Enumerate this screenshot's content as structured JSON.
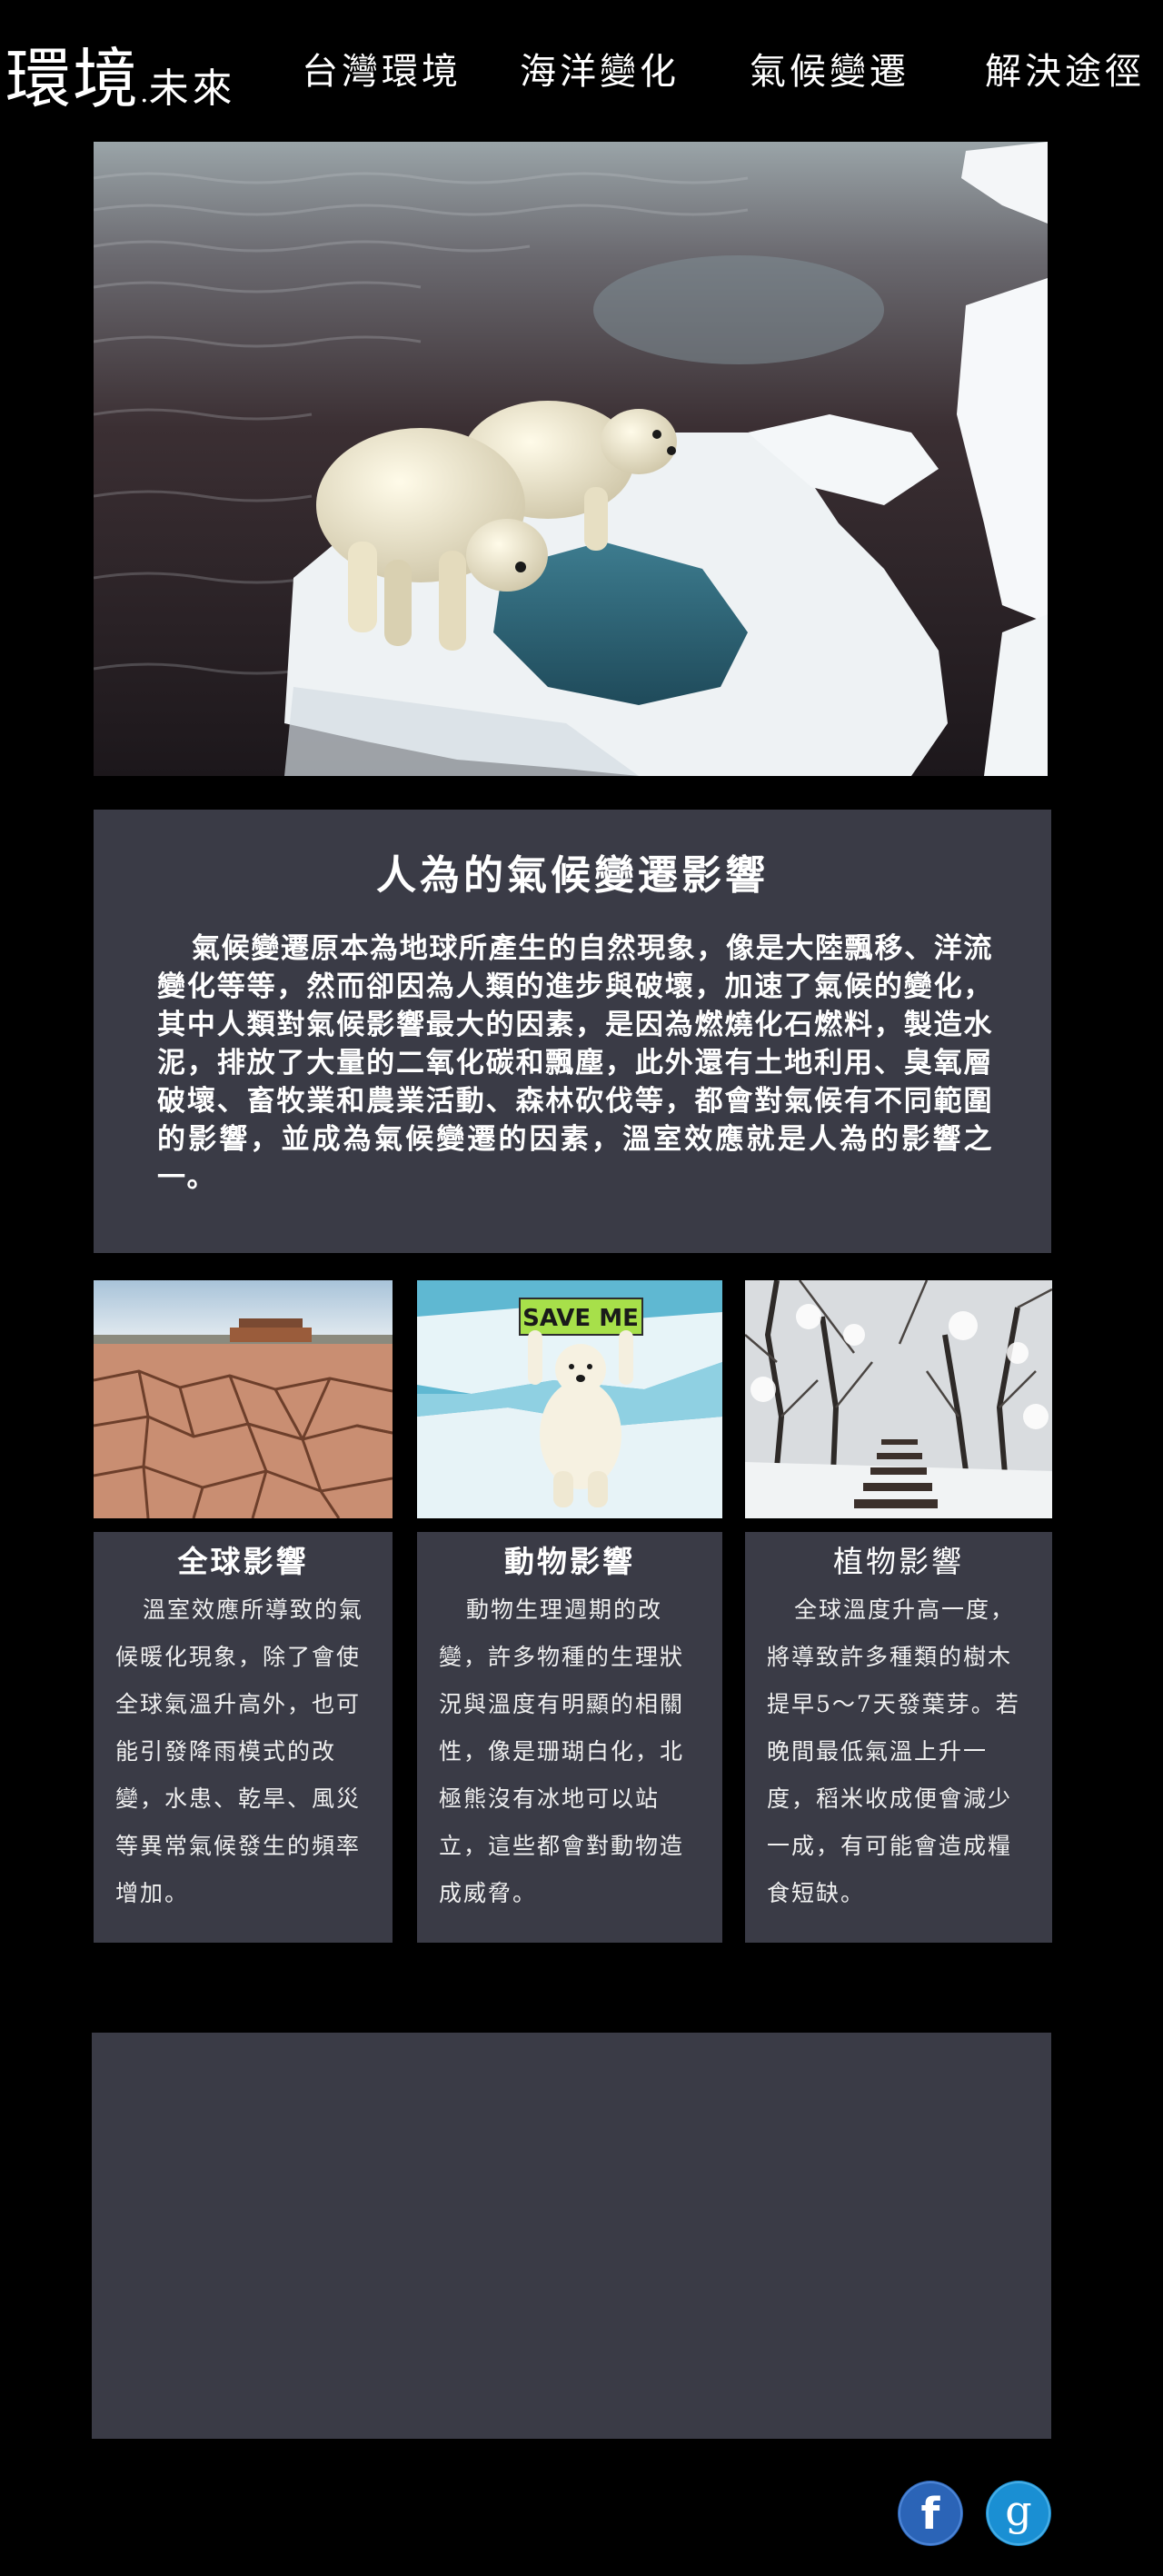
{
  "header": {
    "logo_main": "環境",
    "logo_dot": ".",
    "logo_sub": "未來",
    "nav": [
      {
        "label": "台灣環境"
      },
      {
        "label": "海洋變化"
      },
      {
        "label": "氣候變遷"
      },
      {
        "label": "解決途徑"
      }
    ]
  },
  "hero": {
    "image": "polar-bears-on-melting-ice-floe"
  },
  "intro": {
    "title": "人為的氣候變遷影響",
    "body": "氣候變遷原本為地球所產生的自然現象，像是大陸飄移、洋流變化等等，然而卻因為人類的進步與破壞，加速了氣候的變化，其中人類對氣候影響最大的因素，是因為燃燒化石燃料，製造水泥，排放了大量的二氧化碳和飄塵，此外還有土地利用、臭氧層破壞、畜牧業和農業活動、森林砍伐等，都會對氣候有不同範圍的影響，並成為氣候變遷的因素，溫室效應就是人為的影響之一。"
  },
  "cards": [
    {
      "image": "cracked-dry-earth",
      "title": "全球影響",
      "body": "溫室效應所導致的氣候暖化現象，除了會使全球氣溫升高外，也可能引發降雨模式的改變，水患、乾旱、風災等異常氣候發生的頻率增加。"
    },
    {
      "image": "polar-bear-holding-sign",
      "sign_text": "SAVE ME",
      "title": "動物影響",
      "body": "動物生理週期的改變，許多物種的生理狀況與溫度有明顯的相關性，像是珊瑚白化，北極熊沒有冰地可以站立，這些都會對動物造成威脅。"
    },
    {
      "image": "snowy-forest-stairs",
      "title": "植物影響",
      "body": "全球溫度升高一度，將導致許多種類的樹木提早5～7天發葉芽。若晚間最低氣溫上升一度，稻米收成便會減少一成，有可能會造成糧食短缺。"
    }
  ],
  "social": {
    "facebook": {
      "letter": "f",
      "color": "#2b64b7"
    },
    "google": {
      "letter": "g",
      "color": "#1a8fd3"
    }
  },
  "colors": {
    "background": "#000000",
    "panel": "#3a3b46",
    "text": "#ffffff"
  }
}
